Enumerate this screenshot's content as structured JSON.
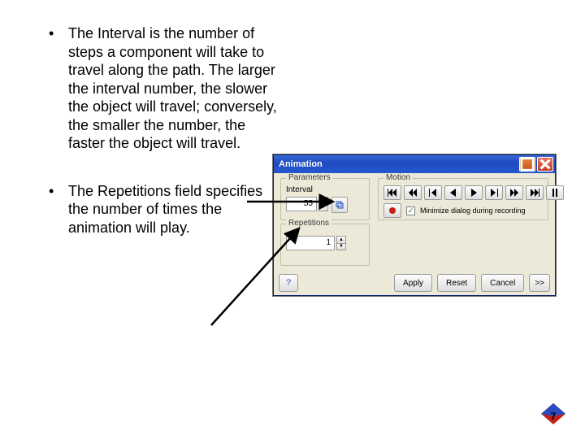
{
  "bullets": {
    "b1": "The Interval is the number of steps a component will take to travel along the path.  The larger the interval number, the slower the object will travel; conversely, the smaller the number, the faster the object will travel.",
    "b2": "The Repetitions field specifies the number of times the animation will play."
  },
  "dialog": {
    "title": "Animation",
    "groups": {
      "parameters": "Parameters",
      "motion": "Motion",
      "repetitions": "Repetitions"
    },
    "interval": {
      "label": "Interval",
      "value": "55"
    },
    "repetitions": {
      "value": "1"
    },
    "minimize_check": {
      "checked": "✓",
      "label": "Minimize dialog during recording"
    },
    "buttons": {
      "apply": "Apply",
      "reset": "Reset",
      "cancel": "Cancel",
      "more": ">>"
    }
  },
  "page_number": "7"
}
